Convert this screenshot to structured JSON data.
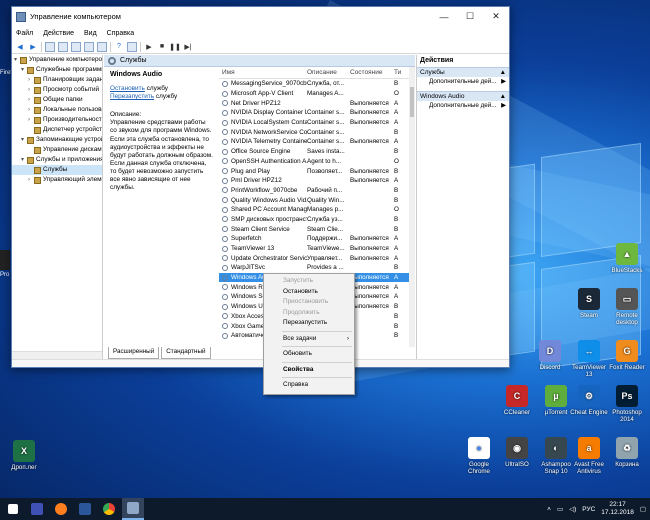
{
  "window": {
    "title": "Управление компьютером",
    "menu": [
      "Файл",
      "Действие",
      "Вид",
      "Справка"
    ]
  },
  "tree": [
    {
      "label": "Управление компьютером (л",
      "level": 0,
      "expander": "▾"
    },
    {
      "label": "Служебные программы",
      "level": 1,
      "expander": "▾"
    },
    {
      "label": "Планировщик заданий",
      "level": 2,
      "expander": "›"
    },
    {
      "label": "Просмотр событий",
      "level": 2,
      "expander": "›"
    },
    {
      "label": "Общие папки",
      "level": 2,
      "expander": "›"
    },
    {
      "label": "Локальные пользовате",
      "level": 2,
      "expander": "›"
    },
    {
      "label": "Производительность",
      "level": 2,
      "expander": "›"
    },
    {
      "label": "Диспетчер устройств",
      "level": 2,
      "expander": ""
    },
    {
      "label": "Запоминающие устройст",
      "level": 1,
      "expander": "▾"
    },
    {
      "label": "Управление дисками",
      "level": 2,
      "expander": ""
    },
    {
      "label": "Службы и приложения",
      "level": 1,
      "expander": "▾"
    },
    {
      "label": "Службы",
      "level": 2,
      "expander": "",
      "selected": true
    },
    {
      "label": "Управляющий элемен",
      "level": 2,
      "expander": "›"
    }
  ],
  "center": {
    "header": "Службы",
    "service_title": "Windows Audio",
    "link_stop": "Остановить",
    "link_stop_suffix": " службу",
    "link_restart": "Перезапустить",
    "link_restart_suffix": " службу",
    "desc_label": "Описание:",
    "desc_text": "Управление средствами работы со звуком для программ Windows. Если эта служба остановлена, то аудиоустройства и эффекты не будут работать должным образом. Если данная служба отключена, то будет невозможно запустить все явно зависящие от нее службы.",
    "columns": [
      "Имя",
      "Описание",
      "Состояние",
      "Ти"
    ],
    "rows": [
      {
        "name": "MessagingService_9070cbe",
        "desc": "Служба, от...",
        "status": "",
        "type": "В"
      },
      {
        "name": "Microsoft App-V Client",
        "desc": "Manages A...",
        "status": "",
        "type": "О"
      },
      {
        "name": "Net Driver HPZ12",
        "desc": "",
        "status": "Выполняется",
        "type": "А"
      },
      {
        "name": "NVIDIA Display Container LS",
        "desc": "Container s...",
        "status": "Выполняется",
        "type": "А"
      },
      {
        "name": "NVIDIA LocalSystem Contain...",
        "desc": "Container s...",
        "status": "Выполняется",
        "type": "А"
      },
      {
        "name": "NVIDIA NetworkService Co...",
        "desc": "Container s...",
        "status": "",
        "type": "В"
      },
      {
        "name": "NVIDIA Telemetry Container",
        "desc": "Container s...",
        "status": "Выполняется",
        "type": "А"
      },
      {
        "name": "Office Source Engine",
        "desc": "Saves insta...",
        "status": "",
        "type": "В"
      },
      {
        "name": "OpenSSH Authentication A...",
        "desc": "Agent to h...",
        "status": "",
        "type": "О"
      },
      {
        "name": "Plug and Play",
        "desc": "Позволяет...",
        "status": "Выполняется",
        "type": "В"
      },
      {
        "name": "Pml Driver HPZ12",
        "desc": "",
        "status": "Выполняется",
        "type": "А"
      },
      {
        "name": "PrintWorkflow_9070cbe",
        "desc": "Рабочий п...",
        "status": "",
        "type": "В"
      },
      {
        "name": "Quality Windows Audio Vid...",
        "desc": "Quality Win...",
        "status": "",
        "type": "В"
      },
      {
        "name": "Shared PC Account Manager",
        "desc": "Manages p...",
        "status": "",
        "type": "О"
      },
      {
        "name": "SMP дисковых пространст...",
        "desc": "Служба уз...",
        "status": "",
        "type": "В"
      },
      {
        "name": "Steam Client Service",
        "desc": "Steam Clie...",
        "status": "",
        "type": "В"
      },
      {
        "name": "Superfetch",
        "desc": "Поддержи...",
        "status": "Выполняется",
        "type": "А"
      },
      {
        "name": "TeamViewer 13",
        "desc": "TeamViewe...",
        "status": "Выполняется",
        "type": "А"
      },
      {
        "name": "Update Orchestrator Service",
        "desc": "Управляет...",
        "status": "Выполняется",
        "type": "А"
      },
      {
        "name": "WarpJITSvc",
        "desc": "Provides a ...",
        "status": "",
        "type": "В"
      },
      {
        "name": "Windows Audio",
        "desc": "",
        "status": "Выполняется",
        "type": "А",
        "selected": true
      },
      {
        "name": "Windows Res",
        "desc": "",
        "status": "Выполняется",
        "type": "А"
      },
      {
        "name": "Windows Sea",
        "desc": "",
        "status": "Выполняется",
        "type": "А"
      },
      {
        "name": "Windows Upd",
        "desc": "",
        "status": "Выполняется",
        "type": "В"
      },
      {
        "name": "Xbox Access",
        "desc": "",
        "status": "",
        "type": "В"
      },
      {
        "name": "Xbox Game M",
        "desc": "",
        "status": "",
        "type": "В"
      },
      {
        "name": "Автоматичес",
        "desc": "",
        "status": "",
        "type": "В"
      }
    ],
    "tabs": [
      "Расширенный",
      "Стандартный"
    ]
  },
  "actions": {
    "title": "Действия",
    "sec1": "Службы",
    "sec1_item": "Дополнительные дей...",
    "sec2": "Windows Audio",
    "sec2_item": "Дополнительные дей..."
  },
  "context_menu": {
    "start": "Запустить",
    "stop": "Остановить",
    "pause": "Приостановить",
    "resume": "Продолжить",
    "restart": "Перезапустить",
    "all_tasks": "Все задачи",
    "refresh": "Обновить",
    "properties": "Свойства",
    "help": "Справка"
  },
  "desktop_icons": [
    {
      "label": "BlueStacks",
      "color": "#6fb83f",
      "glyph": "▲"
    },
    {
      "label": "Steam",
      "color": "#1b2838",
      "glyph": "S"
    },
    {
      "label": "Remote desktop",
      "color": "#555555",
      "glyph": "▭"
    },
    {
      "label": "Discord",
      "color": "#7289da",
      "glyph": "D"
    },
    {
      "label": "TeamViewer 13",
      "color": "#0e8ee9",
      "glyph": "↔"
    },
    {
      "label": "Foxit Reader",
      "color": "#f08b1d",
      "glyph": "G"
    },
    {
      "label": "CCleaner",
      "color": "#c62828",
      "glyph": "C"
    },
    {
      "label": "µTorrent",
      "color": "#5fae3d",
      "glyph": "µ"
    },
    {
      "label": "Cheat Engine",
      "color": "#1565c0",
      "glyph": "⚙"
    },
    {
      "label": "Photoshop 2014",
      "color": "#001d34",
      "glyph": "Ps"
    },
    {
      "label": "Google Chrome",
      "color": "#ffffff",
      "glyph": "●"
    },
    {
      "label": "UltraISO",
      "color": "#444444",
      "glyph": "◉"
    },
    {
      "label": "Ashampoo Snap 10",
      "color": "#37474f",
      "glyph": "◐"
    },
    {
      "label": "Avast Free Antivirus",
      "color": "#f57c00",
      "glyph": "a"
    },
    {
      "label": "Корзина",
      "color": "#90a4ae",
      "glyph": "♻"
    }
  ],
  "left_icon": {
    "label": "Дроп.лег",
    "color": "#1e7145",
    "glyph": "X"
  },
  "taskbar": {
    "lang": "РУС",
    "time": "22:17",
    "date": "17.12.2018"
  }
}
